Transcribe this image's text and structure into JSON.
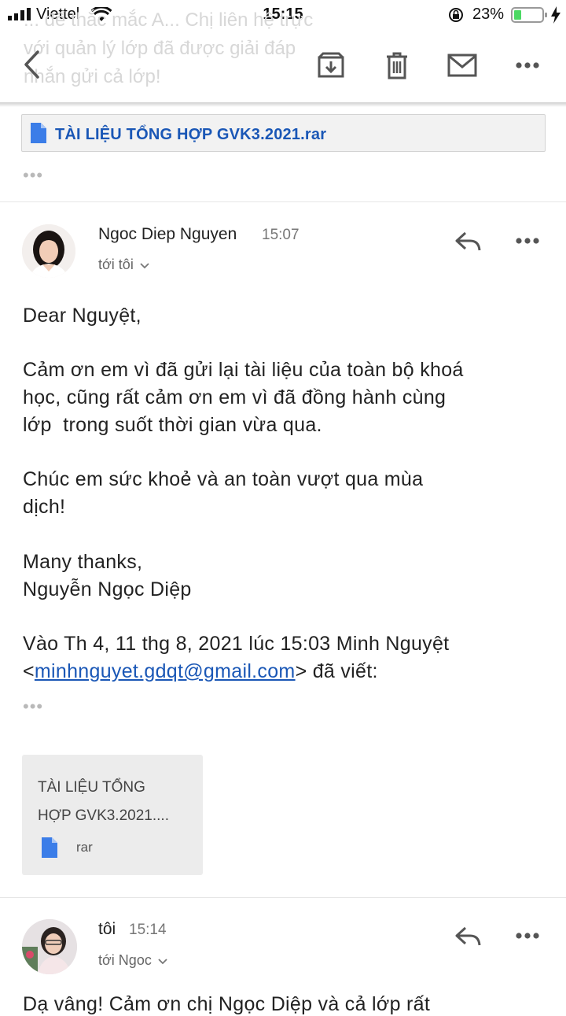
{
  "status_bar": {
    "carrier": "Viettel",
    "time": "15:15",
    "battery_percent": "23%"
  },
  "header": {
    "background_text": "... để thắc mắc A... Chị liên hệ trực\nvới quản lý lớp đã được giải đáp\nnhắn gửi cả lớp!"
  },
  "attachment_top": {
    "filename": "TÀI LIỆU TỔNG HỢP GVK3.2021.rar"
  },
  "collapsed_dots": "•••",
  "message1": {
    "sender": "Ngoc Diep Nguyen",
    "time": "15:07",
    "recipient": "tới tôi",
    "greeting": "Dear Nguyệt,",
    "para1_line1": "Cảm ơn em vì đã gửi lại tài liệu của toàn bộ khoá",
    "para1_line2": "học, cũng rất cảm ơn em vì đã đồng hành cùng",
    "para1_line3": "lớp  trong suốt thời gian vừa qua.",
    "para2_line1": "Chúc em sức khoẻ và an toàn vượt qua mùa",
    "para2_line2": "dịch!",
    "signoff1": "Many thanks,",
    "signoff2": "Nguyễn Ngọc Diệp",
    "quote_line1": "Vào Th 4, 11 thg 8, 2021 lúc 15:03 Minh Nguyệt",
    "quote_lt": "<",
    "quote_email": "minhnguyet.gdqt@gmail.com",
    "quote_tail": "> đã viết:",
    "attachment_title_1": "TÀI LIỆU TỔNG",
    "attachment_title_2": "HỢP GVK3.2021....",
    "attachment_ext": "rar"
  },
  "message2": {
    "sender": "tôi",
    "time": "15:14",
    "recipient": "tới Ngoc",
    "preview": "Dạ vâng! Cảm ơn chị Ngọc Diệp và cả lớp rất"
  },
  "colors": {
    "link": "#1a57b6",
    "file_icon": "#3b7de8",
    "gray_text": "#777777"
  }
}
